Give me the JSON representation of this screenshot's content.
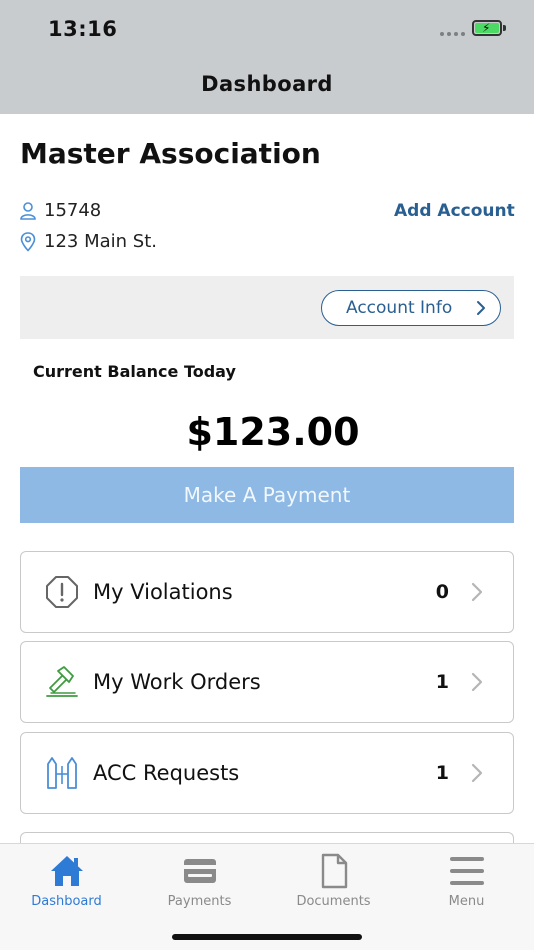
{
  "status": {
    "time": "13:16"
  },
  "nav": {
    "title": "Dashboard"
  },
  "association": {
    "name": "Master Association",
    "account_number": "15748",
    "address": "123 Main St.",
    "add_account_label": "Add Account",
    "account_info_label": "Account Info"
  },
  "balance": {
    "label": "Current Balance Today",
    "amount": "$123.00",
    "pay_label": "Make A Payment"
  },
  "cards": [
    {
      "label": "My Violations",
      "count": "0",
      "icon": "alert-octagon-icon"
    },
    {
      "label": "My Work Orders",
      "count": "1",
      "icon": "hammer-icon"
    },
    {
      "label": "ACC Requests",
      "count": "1",
      "icon": "architecture-icon"
    }
  ],
  "tabs": [
    {
      "label": "Dashboard",
      "icon": "home-icon",
      "active": true
    },
    {
      "label": "Payments",
      "icon": "credit-card-icon",
      "active": false
    },
    {
      "label": "Documents",
      "icon": "document-icon",
      "active": false
    },
    {
      "label": "Menu",
      "icon": "hamburger-menu-icon",
      "active": false
    }
  ],
  "colors": {
    "accent": "#2a5f91",
    "pay_button": "#8db9e4",
    "active_tab": "#2e7bd6",
    "work_order_icon": "#3f9b3f",
    "acc_icon": "#4a8fd8"
  }
}
